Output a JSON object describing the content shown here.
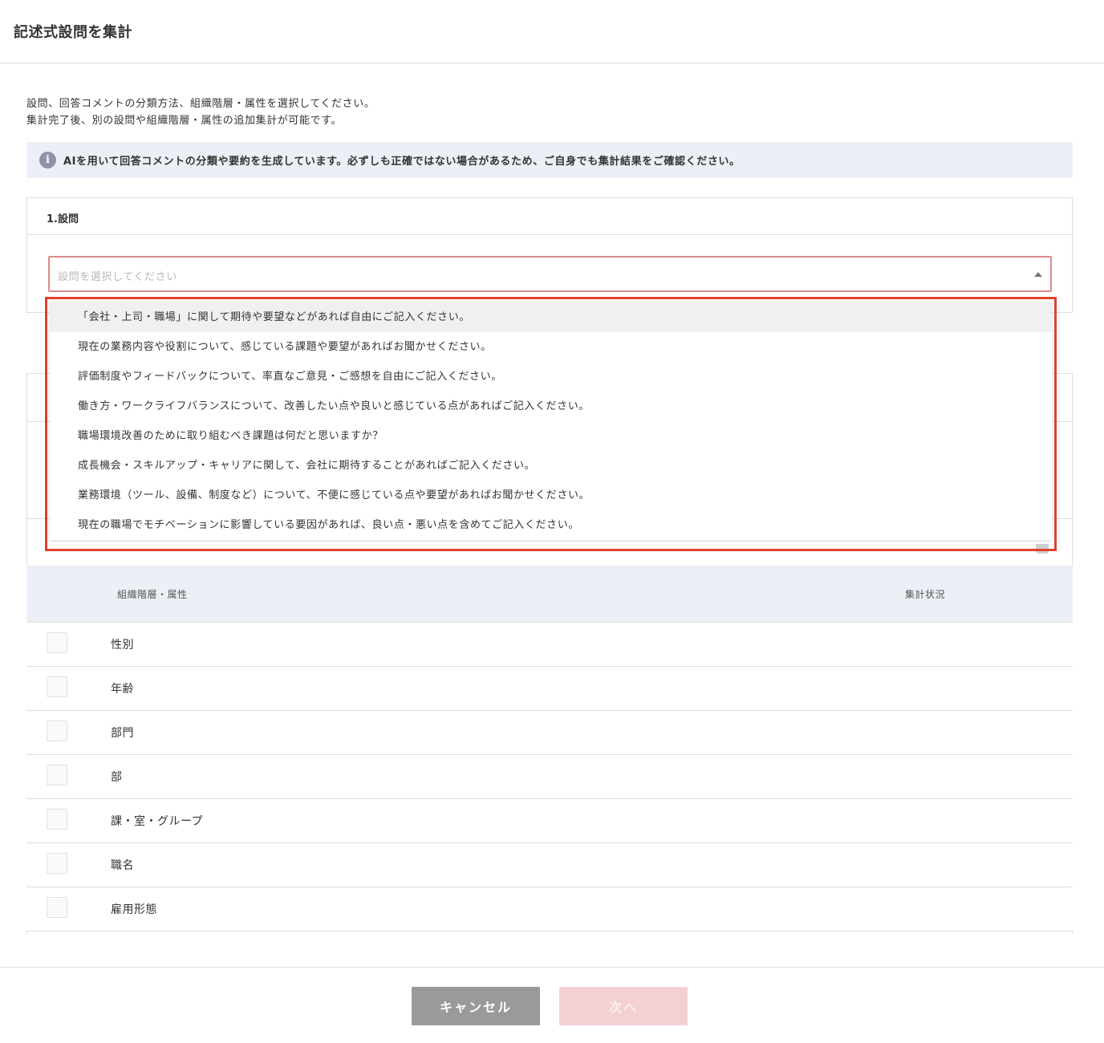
{
  "header": {
    "title": "記述式設問を集計"
  },
  "description": {
    "line1": "設問、回答コメントの分類方法、組織階層・属性を選択してください。",
    "line2": "集計完了後、別の設問や組織階層・属性の追加集計が可能です。"
  },
  "notice": {
    "icon": "info-icon",
    "icon_glyph": "i",
    "text": "AIを用いて回答コメントの分類や要約を生成しています。必ずしも正確ではない場合があるため、ご自身でも集計結果をご確認ください。"
  },
  "question_section": {
    "title": "1.設問",
    "select_placeholder": "設問を選択してください"
  },
  "dropdown": {
    "options": [
      "「会社・上司・職場」に関して期待や要望などがあれば自由にご記入ください。",
      "現在の業務内容や役割について、感じている課題や要望があればお聞かせください。",
      "評価制度やフィードバックについて、率直なご意見・ご感想を自由にご記入ください。",
      "働き方・ワークライフバランスについて、改善したい点や良いと感じている点があればご記入ください。",
      "職場環境改善のために取り組むべき課題は何だと思いますか？",
      "成長機会・スキルアップ・キャリアに関して、会社に期待することがあればご記入ください。",
      "業務環境（ツール、設備、制度など）について、不便に感じている点や要望があればお聞かせください。",
      "現在の職場でモチベーションに影響している要因があれば、良い点・悪い点を含めてご記入ください。"
    ]
  },
  "table": {
    "col_attribute": "組織階層・属性",
    "col_status": "集計状況",
    "rows": [
      "性別",
      "年齢",
      "部門",
      "部",
      "課・室・グループ",
      "職名",
      "雇用形態"
    ]
  },
  "footer": {
    "cancel_label": "キャンセル",
    "next_label": "次へ"
  },
  "colors": {
    "highlight_frame": "#e0402e",
    "select_border": "#d88a8a",
    "notice_bg": "#eceff5",
    "cancel_bg": "#9a9a9a",
    "next_bg": "#f3d1d3"
  }
}
